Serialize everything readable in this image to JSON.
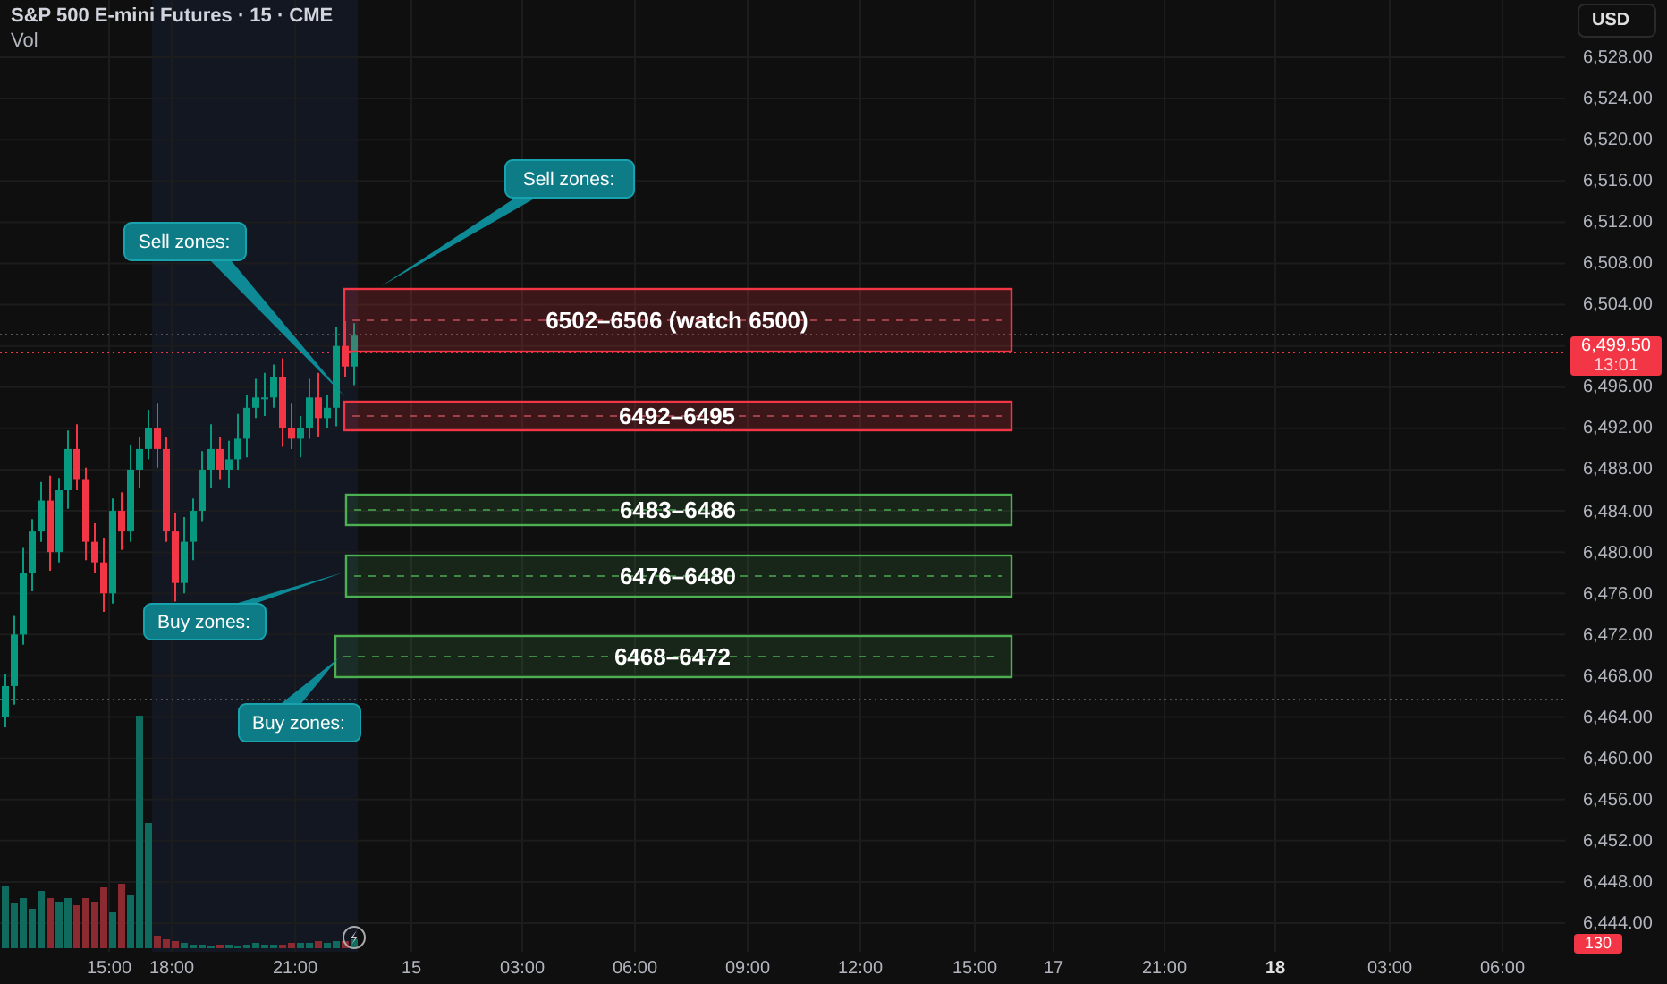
{
  "header": {
    "title": "S&P 500 E-mini Futures · 15 · CME",
    "indicator": "Vol"
  },
  "currency_button": "USD",
  "price_axis": [
    "6,528.00",
    "6,524.00",
    "6,520.00",
    "6,516.00",
    "6,512.00",
    "6,508.00",
    "6,504.00",
    "6,496.00",
    "6,492.00",
    "6,488.00",
    "6,484.00",
    "6,480.00",
    "6,476.00",
    "6,472.00",
    "6,468.00",
    "6,464.00",
    "6,460.00",
    "6,456.00",
    "6,452.00",
    "6,448.00",
    "6,444.00"
  ],
  "last_price": {
    "price": "6,499.50",
    "countdown": "13:01"
  },
  "volume_tag": "130",
  "time_axis": [
    {
      "label": "15:00",
      "emphasis": false
    },
    {
      "label": "18:00",
      "emphasis": false
    },
    {
      "label": "21:00",
      "emphasis": false
    },
    {
      "label": "15",
      "emphasis": false
    },
    {
      "label": "03:00",
      "emphasis": false
    },
    {
      "label": "06:00",
      "emphasis": false
    },
    {
      "label": "09:00",
      "emphasis": false
    },
    {
      "label": "12:00",
      "emphasis": false
    },
    {
      "label": "15:00",
      "emphasis": false
    },
    {
      "label": "17",
      "emphasis": false
    },
    {
      "label": "21:00",
      "emphasis": false
    },
    {
      "label": "18",
      "emphasis": true
    },
    {
      "label": "03:00",
      "emphasis": false
    },
    {
      "label": "06:00",
      "emphasis": false
    }
  ],
  "zones": [
    {
      "label": "6502–6506 (watch 6500)",
      "kind": "sell"
    },
    {
      "label": "6492–6495",
      "kind": "sell"
    },
    {
      "label": "6483–6486",
      "kind": "buy"
    },
    {
      "label": "6476–6480",
      "kind": "buy"
    },
    {
      "label": "6468–6472",
      "kind": "buy"
    }
  ],
  "callouts": [
    {
      "text": "Sell zones:"
    },
    {
      "text": "Sell zones:"
    },
    {
      "text": "Buy zones:"
    },
    {
      "text": "Buy zones:"
    }
  ]
}
